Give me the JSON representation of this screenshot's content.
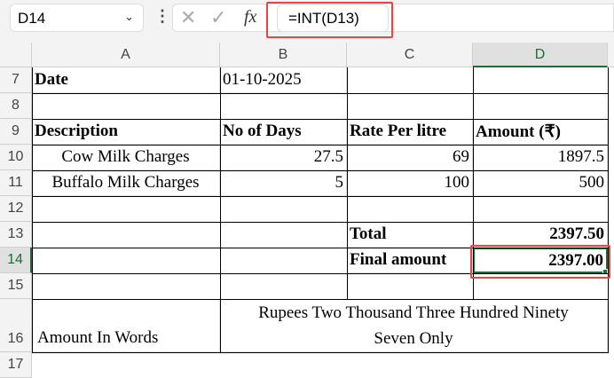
{
  "formula_bar": {
    "name_box": "D14",
    "formula": "=INT(D13)",
    "cancel_icon": "x-icon",
    "enter_icon": "check-icon",
    "fx_label": "fx"
  },
  "columns": [
    "A",
    "B",
    "C",
    "D"
  ],
  "rows": [
    "7",
    "8",
    "9",
    "10",
    "11",
    "12",
    "13",
    "14",
    "15",
    "16",
    "17"
  ],
  "cells": {
    "A7": "Date",
    "B7": "01-10-2025",
    "A9": "Description",
    "B9": "No of Days",
    "C9": "Rate Per litre",
    "D9": "Amount (₹)",
    "A10": "Cow Milk Charges",
    "B10": "27.5",
    "C10": "69",
    "D10": "1897.5",
    "A11": "Buffalo Milk Charges",
    "B11": "5",
    "C11": "100",
    "D11": "500",
    "C13": "Total",
    "D13": "2397.50",
    "C14": "Final amount",
    "D14": "2397.00",
    "A16": "Amount In Words",
    "B16": "Rupees Two Thousand Three Hundred Ninety Seven Only"
  },
  "selected_cell": "D14",
  "colors": {
    "selection": "#1e6b3a",
    "highlight": "#e84545"
  }
}
